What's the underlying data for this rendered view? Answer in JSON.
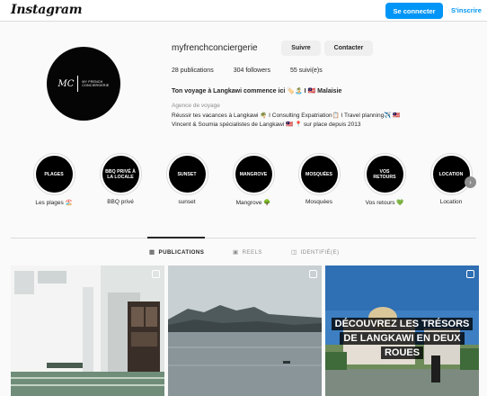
{
  "header": {
    "logo": "Instagram",
    "login_label": "Se connecter",
    "signup_label": "S'inscrire"
  },
  "profile": {
    "avatar_monogram": "MC",
    "avatar_brand_line1": "MY FRENCH",
    "avatar_brand_line2": "CONCIERGERIE",
    "username": "myfrenchconciergerie",
    "follow_label": "Suivre",
    "contact_label": "Contacter",
    "stats": {
      "publications": "28 publications",
      "followers": "304 followers",
      "following": "55 suivi(e)s"
    },
    "bio": {
      "title": "Ton voyage à Langkawi commence ici 🏷️🏝️ I 🇲🇾 Malaisie",
      "category": "Agence de voyage",
      "line1": "Réussir tes vacances à Langkawi 🌴 I Consulting Expatriation📋 I Travel planning✈️ 🇲🇾",
      "line2": "Vincent & Soumia spécialistes de Langkawi 🇲🇾 📍 sur place depuis 2013"
    }
  },
  "highlights": [
    {
      "circle": "PLAGES",
      "label": "Les plages 🏖️"
    },
    {
      "circle": "BBQ PRIVÉ À LA LOCALE",
      "label": "BBQ privé"
    },
    {
      "circle": "SUNSET",
      "label": "sunset"
    },
    {
      "circle": "MANGROVE",
      "label": "Mangrove 🌳"
    },
    {
      "circle": "MOSQUÉES",
      "label": "Mosquées"
    },
    {
      "circle": "VOS RETOURS",
      "label": "Vos retours 💚"
    },
    {
      "circle": "LOCATION",
      "label": "Location"
    }
  ],
  "tabs": {
    "publications": "PUBLICATIONS",
    "reels": "REELS",
    "tagged": "IDENTIFIÉ(E)"
  },
  "posts": {
    "post3_overlay_line1": "DÉCOUVREZ LES TRÉSORS",
    "post3_overlay_line2": "DE LANGKAWI EN DEUX",
    "post3_overlay_line3": "ROUES"
  },
  "colors": {
    "accent": "#0095f6",
    "text": "#262626",
    "muted": "#8e8e8e",
    "border": "#dbdbdb"
  },
  "icons": {
    "publications": "grid-icon",
    "reels": "reels-icon",
    "tagged": "tagged-icon",
    "highlights_next": "chevron-right-icon"
  }
}
